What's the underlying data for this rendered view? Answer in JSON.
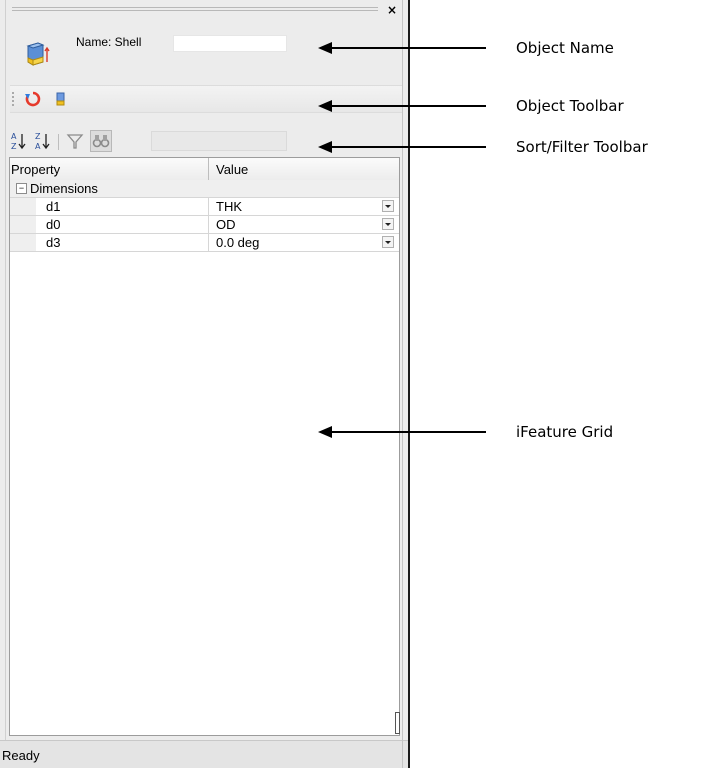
{
  "panel": {
    "close_label": "×",
    "name_label": "Name: Shell",
    "filter_placeholder": "",
    "grid": {
      "columns": [
        "Property",
        "Value"
      ],
      "group": {
        "expander": "−",
        "label": "Dimensions"
      },
      "rows": [
        {
          "property": "d1",
          "value": "THK"
        },
        {
          "property": "d0",
          "value": "OD"
        },
        {
          "property": "d3",
          "value": "0.0 deg"
        }
      ]
    },
    "status": "Ready"
  },
  "icons": {
    "object": "part-icon",
    "object_toolbar": [
      "refresh-icon",
      "part-small-icon"
    ],
    "sort_toolbar": [
      "sort-ascending-icon",
      "sort-descending-icon",
      "filter-icon",
      "find-icon"
    ]
  },
  "callouts": {
    "object_name": "Object Name",
    "object_toolbar": "Object Toolbar",
    "sort_filter_toolbar": "Sort/Filter Toolbar",
    "ifeature_grid": "iFeature Grid"
  },
  "colors": {
    "panel_bg": "#ececec",
    "refresh_red": "#e63a2c",
    "part_blue": "#4a7fc8",
    "part_yellow": "#f0c020"
  }
}
